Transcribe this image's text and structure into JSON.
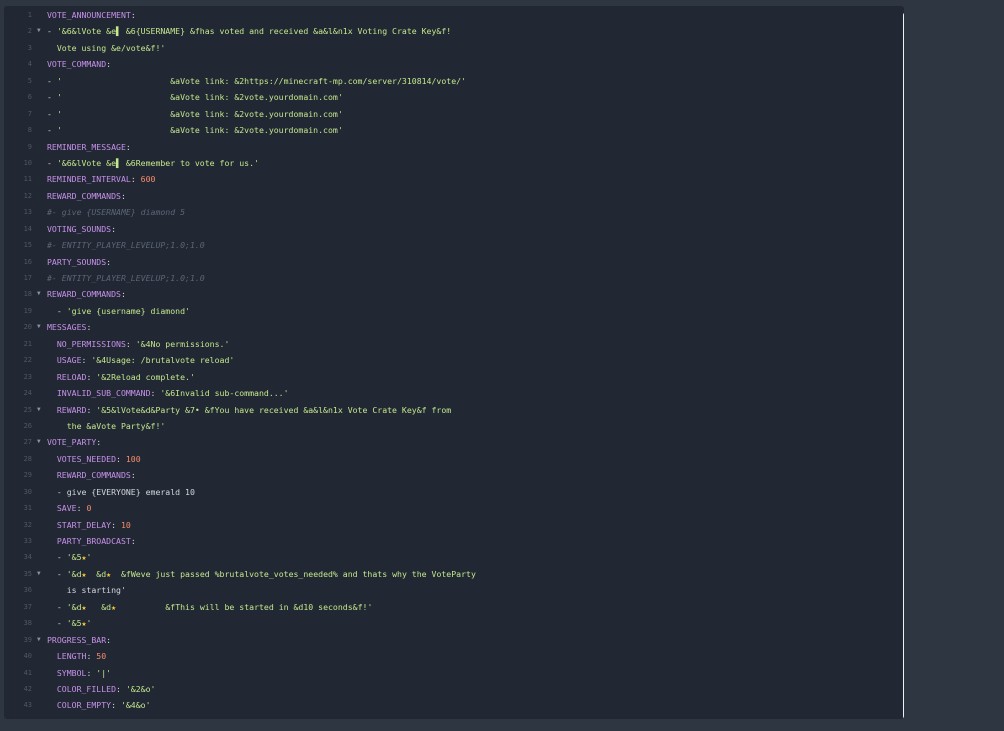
{
  "editor": {
    "lines": [
      {
        "n": "1",
        "fold": false,
        "parts": [
          {
            "t": "VOTE_ANNOUNCEMENT",
            "c": "k"
          },
          {
            "t": ":",
            "c": "t"
          }
        ]
      },
      {
        "n": "2",
        "fold": true,
        "parts": [
          {
            "t": "- ",
            "c": "t"
          },
          {
            "t": "'&6&lVote &e▌ &6{USERNAME} &fhas voted and received &a&l&n1x Voting Crate Key&f!",
            "c": "s"
          }
        ]
      },
      {
        "n": "3",
        "fold": false,
        "parts": [
          {
            "t": "  Vote using &e/vote&f!'",
            "c": "s"
          }
        ]
      },
      {
        "n": "4",
        "fold": false,
        "parts": [
          {
            "t": "VOTE_COMMAND",
            "c": "k"
          },
          {
            "t": ":",
            "c": "t"
          }
        ]
      },
      {
        "n": "5",
        "fold": false,
        "parts": [
          {
            "t": "- ",
            "c": "t"
          },
          {
            "t": "'                      &aVote link: &2https://minecraft-mp.com/server/310814/vote/'",
            "c": "s"
          }
        ]
      },
      {
        "n": "6",
        "fold": false,
        "parts": [
          {
            "t": "- ",
            "c": "t"
          },
          {
            "t": "'                      &aVote link: &2vote.yourdomain.com'",
            "c": "s"
          }
        ]
      },
      {
        "n": "7",
        "fold": false,
        "parts": [
          {
            "t": "- ",
            "c": "t"
          },
          {
            "t": "'                      &aVote link: &2vote.yourdomain.com'",
            "c": "s"
          }
        ]
      },
      {
        "n": "8",
        "fold": false,
        "parts": [
          {
            "t": "- ",
            "c": "t"
          },
          {
            "t": "'                      &aVote link: &2vote.yourdomain.com'",
            "c": "s"
          }
        ]
      },
      {
        "n": "9",
        "fold": false,
        "parts": [
          {
            "t": "REMINDER_MESSAGE",
            "c": "k"
          },
          {
            "t": ":",
            "c": "t"
          }
        ]
      },
      {
        "n": "10",
        "fold": false,
        "parts": [
          {
            "t": "- ",
            "c": "t"
          },
          {
            "t": "'&6&lVote &e▌ &6Remember to vote for us.'",
            "c": "s"
          }
        ]
      },
      {
        "n": "11",
        "fold": false,
        "parts": [
          {
            "t": "REMINDER_INTERVAL",
            "c": "k"
          },
          {
            "t": ": ",
            "c": "t"
          },
          {
            "t": "600",
            "c": "n"
          }
        ]
      },
      {
        "n": "12",
        "fold": false,
        "parts": [
          {
            "t": "REWARD_COMMANDS",
            "c": "k"
          },
          {
            "t": ":",
            "c": "t"
          }
        ]
      },
      {
        "n": "13",
        "fold": false,
        "parts": [
          {
            "t": "#- give {USERNAME} diamond 5",
            "c": "c"
          }
        ]
      },
      {
        "n": "14",
        "fold": false,
        "parts": [
          {
            "t": "VOTING_SOUNDS",
            "c": "k"
          },
          {
            "t": ":",
            "c": "t"
          }
        ]
      },
      {
        "n": "15",
        "fold": false,
        "parts": [
          {
            "t": "#- ENTITY_PLAYER_LEVELUP;1.0;1.0",
            "c": "c"
          }
        ]
      },
      {
        "n": "16",
        "fold": false,
        "parts": [
          {
            "t": "PARTY_SOUNDS",
            "c": "k"
          },
          {
            "t": ":",
            "c": "t"
          }
        ]
      },
      {
        "n": "17",
        "fold": false,
        "parts": [
          {
            "t": "#- ENTITY_PLAYER_LEVELUP;1.0;1.0",
            "c": "c"
          }
        ]
      },
      {
        "n": "18",
        "fold": true,
        "parts": [
          {
            "t": "REWARD_COMMANDS",
            "c": "k"
          },
          {
            "t": ":",
            "c": "t"
          }
        ]
      },
      {
        "n": "19",
        "fold": false,
        "parts": [
          {
            "t": "  - ",
            "c": "t"
          },
          {
            "t": "'give {username} diamond'",
            "c": "s"
          }
        ]
      },
      {
        "n": "20",
        "fold": true,
        "parts": [
          {
            "t": "MESSAGES",
            "c": "k"
          },
          {
            "t": ":",
            "c": "t"
          }
        ]
      },
      {
        "n": "21",
        "fold": false,
        "parts": [
          {
            "t": "  NO_PERMISSIONS",
            "c": "k"
          },
          {
            "t": ": ",
            "c": "t"
          },
          {
            "t": "'&4No permissions.'",
            "c": "s"
          }
        ]
      },
      {
        "n": "22",
        "fold": false,
        "parts": [
          {
            "t": "  USAGE",
            "c": "k"
          },
          {
            "t": ": ",
            "c": "t"
          },
          {
            "t": "'&4Usage: /brutalvote reload'",
            "c": "s"
          }
        ]
      },
      {
        "n": "23",
        "fold": false,
        "parts": [
          {
            "t": "  RELOAD",
            "c": "k"
          },
          {
            "t": ": ",
            "c": "t"
          },
          {
            "t": "'&2Reload complete.'",
            "c": "s"
          }
        ]
      },
      {
        "n": "24",
        "fold": false,
        "parts": [
          {
            "t": "  INVALID_SUB_COMMAND",
            "c": "k"
          },
          {
            "t": ": ",
            "c": "t"
          },
          {
            "t": "'&6Invalid sub-command...'",
            "c": "s"
          }
        ]
      },
      {
        "n": "25",
        "fold": true,
        "parts": [
          {
            "t": "  REWARD",
            "c": "k"
          },
          {
            "t": ": ",
            "c": "t"
          },
          {
            "t": "'&5&lVote&d&Party &7• &fYou have received &a&l&n1x Vote Crate Key&f from",
            "c": "s"
          }
        ]
      },
      {
        "n": "26",
        "fold": false,
        "parts": [
          {
            "t": "    the &aVote Party&f!'",
            "c": "s"
          }
        ]
      },
      {
        "n": "27",
        "fold": true,
        "parts": [
          {
            "t": "VOTE_PARTY",
            "c": "k"
          },
          {
            "t": ":",
            "c": "t"
          }
        ]
      },
      {
        "n": "28",
        "fold": false,
        "parts": [
          {
            "t": "  VOTES_NEEDED",
            "c": "k"
          },
          {
            "t": ": ",
            "c": "t"
          },
          {
            "t": "100",
            "c": "n"
          }
        ]
      },
      {
        "n": "29",
        "fold": false,
        "parts": [
          {
            "t": "  REWARD_COMMANDS",
            "c": "k"
          },
          {
            "t": ":",
            "c": "t"
          }
        ]
      },
      {
        "n": "30",
        "fold": false,
        "parts": [
          {
            "t": "  - give {EVERYONE} emerald 10",
            "c": "t"
          }
        ]
      },
      {
        "n": "31",
        "fold": false,
        "parts": [
          {
            "t": "  SAVE",
            "c": "k"
          },
          {
            "t": ": ",
            "c": "t"
          },
          {
            "t": "0",
            "c": "n"
          }
        ]
      },
      {
        "n": "32",
        "fold": false,
        "parts": [
          {
            "t": "  START_DELAY",
            "c": "k"
          },
          {
            "t": ": ",
            "c": "t"
          },
          {
            "t": "10",
            "c": "n"
          }
        ]
      },
      {
        "n": "33",
        "fold": false,
        "parts": [
          {
            "t": "  PARTY_BROADCAST",
            "c": "k"
          },
          {
            "t": ":",
            "c": "t"
          }
        ]
      },
      {
        "n": "34",
        "fold": false,
        "parts": [
          {
            "t": "  - ",
            "c": "t"
          },
          {
            "t": "'&5",
            "c": "s"
          },
          {
            "t": "★",
            "c": "star"
          },
          {
            "t": "'",
            "c": "s"
          }
        ]
      },
      {
        "n": "35",
        "fold": true,
        "parts": [
          {
            "t": "  - ",
            "c": "t"
          },
          {
            "t": "'&d",
            "c": "s"
          },
          {
            "t": "★",
            "c": "star"
          },
          {
            "t": "  &d",
            "c": "s"
          },
          {
            "t": "★",
            "c": "star"
          },
          {
            "t": "  &fWeve just passed %brutalvote_votes_needed% and thats why the VoteParty",
            "c": "s"
          }
        ]
      },
      {
        "n": "36",
        "fold": false,
        "parts": [
          {
            "t": "    is starting'",
            "c": "t"
          }
        ]
      },
      {
        "n": "37",
        "fold": false,
        "parts": [
          {
            "t": "  - ",
            "c": "t"
          },
          {
            "t": "'&d",
            "c": "s"
          },
          {
            "t": "★",
            "c": "star"
          },
          {
            "t": "   &d",
            "c": "s"
          },
          {
            "t": "★",
            "c": "star"
          },
          {
            "t": "          &fThis will be started in &d10 seconds&f!'",
            "c": "s"
          }
        ]
      },
      {
        "n": "38",
        "fold": false,
        "parts": [
          {
            "t": "  - ",
            "c": "t"
          },
          {
            "t": "'&5",
            "c": "s"
          },
          {
            "t": "★",
            "c": "star"
          },
          {
            "t": "'",
            "c": "s"
          }
        ]
      },
      {
        "n": "39",
        "fold": true,
        "parts": [
          {
            "t": "PROGRESS_BAR",
            "c": "k"
          },
          {
            "t": ":",
            "c": "t"
          }
        ]
      },
      {
        "n": "40",
        "fold": false,
        "parts": [
          {
            "t": "  LENGTH",
            "c": "k"
          },
          {
            "t": ": ",
            "c": "t"
          },
          {
            "t": "50",
            "c": "n"
          }
        ]
      },
      {
        "n": "41",
        "fold": false,
        "parts": [
          {
            "t": "  SYMBOL",
            "c": "k"
          },
          {
            "t": ": ",
            "c": "t"
          },
          {
            "t": "'|'",
            "c": "s"
          }
        ]
      },
      {
        "n": "42",
        "fold": false,
        "parts": [
          {
            "t": "  COLOR_FILLED",
            "c": "k"
          },
          {
            "t": ": ",
            "c": "t"
          },
          {
            "t": "'&2&o'",
            "c": "s"
          }
        ]
      },
      {
        "n": "43",
        "fold": false,
        "parts": [
          {
            "t": "  COLOR_EMPTY",
            "c": "k"
          },
          {
            "t": ": ",
            "c": "t"
          },
          {
            "t": "'&4&o'",
            "c": "s"
          }
        ]
      }
    ]
  },
  "colors": {
    "page_bg": "#2e3642",
    "editor_bg": "#212733",
    "key": "#c792ea",
    "string": "#c3e88d",
    "number": "#f78c6c",
    "comment": "#5c6677",
    "star": "#ffcb3b"
  },
  "icons": {
    "fold": "fold-arrow-icon"
  }
}
